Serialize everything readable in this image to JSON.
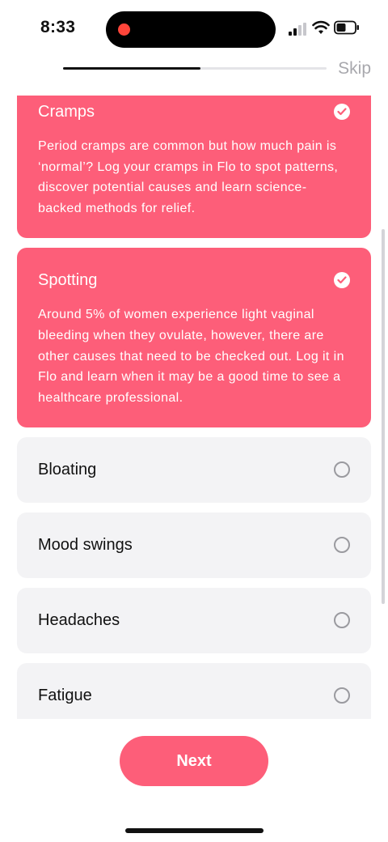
{
  "status_bar": {
    "time": "8:33"
  },
  "header": {
    "skip_label": "Skip",
    "progress_fraction": 0.52
  },
  "options": [
    {
      "title": "Cramps",
      "selected": true,
      "description": "Period cramps are common but how much pain is ‘normal’? Log your cramps in Flo to spot patterns, discover potential causes and learn science-backed methods for relief."
    },
    {
      "title": "Spotting",
      "selected": true,
      "description": "Around 5% of women experience light vaginal bleeding when they ovulate, however, there are other causes that need to be checked out. Log it in Flo and learn when it may be a good time to see a healthcare professional."
    },
    {
      "title": "Bloating",
      "selected": false
    },
    {
      "title": "Mood swings",
      "selected": false
    },
    {
      "title": "Headaches",
      "selected": false
    },
    {
      "title": "Fatigue",
      "selected": false
    }
  ],
  "footer": {
    "next_label": "Next"
  },
  "colors": {
    "accent": "#fd5e79",
    "card_bg": "#f3f3f5",
    "skip_text": "#a8a8ad"
  }
}
